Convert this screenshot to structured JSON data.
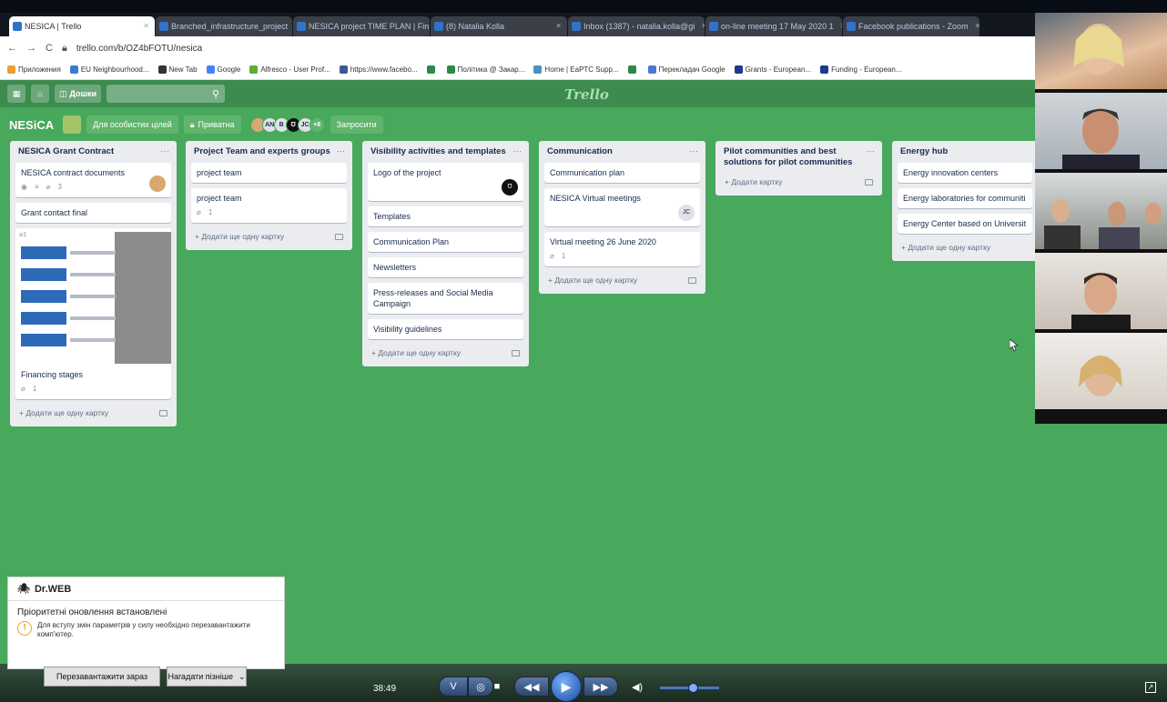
{
  "browser": {
    "tabs": [
      {
        "label": "NESICA | Trello",
        "active": true
      },
      {
        "label": "Branched_infrastructure_project",
        "active": false
      },
      {
        "label": "NESICA project TIME PLAN | Fin",
        "active": false
      },
      {
        "label": "(8) Natalia Kolla",
        "active": false
      },
      {
        "label": "Inbox (1387) - natalia.kolla@gi",
        "active": false
      },
      {
        "label": "on-line meeting 17 May 2020 1",
        "active": false
      },
      {
        "label": "Facebook publications - Zoom",
        "active": false
      }
    ],
    "url": "trello.com/b/OZ4bFOTU/nesica",
    "bookmarks": [
      "Приложения",
      "EU Neighbourhood...",
      "New Tab",
      "Google",
      "Alfresco - User Prof...",
      "https://www.facebo...",
      "",
      "Політика @ Закар...",
      "Home | EaPTC Supp...",
      "",
      "Перекладач Google",
      "Grants - European...",
      "Funding - European..."
    ]
  },
  "trello": {
    "boards_label": "Дошки",
    "logo": "Trello",
    "board_name": "NESiCA",
    "team_label": "Для особистих цілей",
    "visibility_label": "Приватна",
    "members": [
      "AN",
      "B",
      "",
      "JC"
    ],
    "more_members": "+8",
    "invite_label": "Запросити"
  },
  "lists": [
    {
      "title": "NESICA Grant Contract",
      "add": "+ Додати ще одну картку"
    },
    {
      "title": "Project Team and experts groups",
      "add": "+ Додати ще одну картку"
    },
    {
      "title": "Visibility activities and templates",
      "add": "+ Додати ще одну картку"
    },
    {
      "title": "Communication",
      "add": "+ Додати ще одну картку"
    },
    {
      "title": "Pilot communities and best solutions for pilot communities",
      "add": "+ Додати картку"
    },
    {
      "title": "Energy hub",
      "add": "+ Додати ще одну картку"
    }
  ],
  "cards": {
    "l0": [
      "NESICA contract documents",
      "Grant contact final",
      "Financing stages"
    ],
    "l0_badges": [
      "3",
      "1"
    ],
    "l0_cover_badge": "1",
    "l1": [
      "project team",
      "project team"
    ],
    "l1_badge": "1",
    "l2": [
      "Logo of the project",
      "Templates",
      "Communication Plan",
      "Newsletters",
      "Press-releases and Social Media Campaign",
      "Visibility guidelines"
    ],
    "l3": [
      "Communication plan",
      "NESICA Virtual meetings",
      "Virtual meeting 26 June 2020"
    ],
    "l3_member": "JC",
    "l3_badge": "1",
    "l5": [
      "Energy innovation centers",
      "Energy laboratories for communiti",
      "Energy Center based on Universit"
    ]
  },
  "drweb": {
    "brand": "Dr.WEB",
    "title": "Пріоритетні оновлення встановлені",
    "message": "Для вступу змін параметрів у силу необхідно перезавантажити комп'ютер.",
    "restart": "Перезавантажити зараз",
    "later": "Нагадати пізніше"
  },
  "player": {
    "time": "38:49",
    "volume": 0.55
  }
}
